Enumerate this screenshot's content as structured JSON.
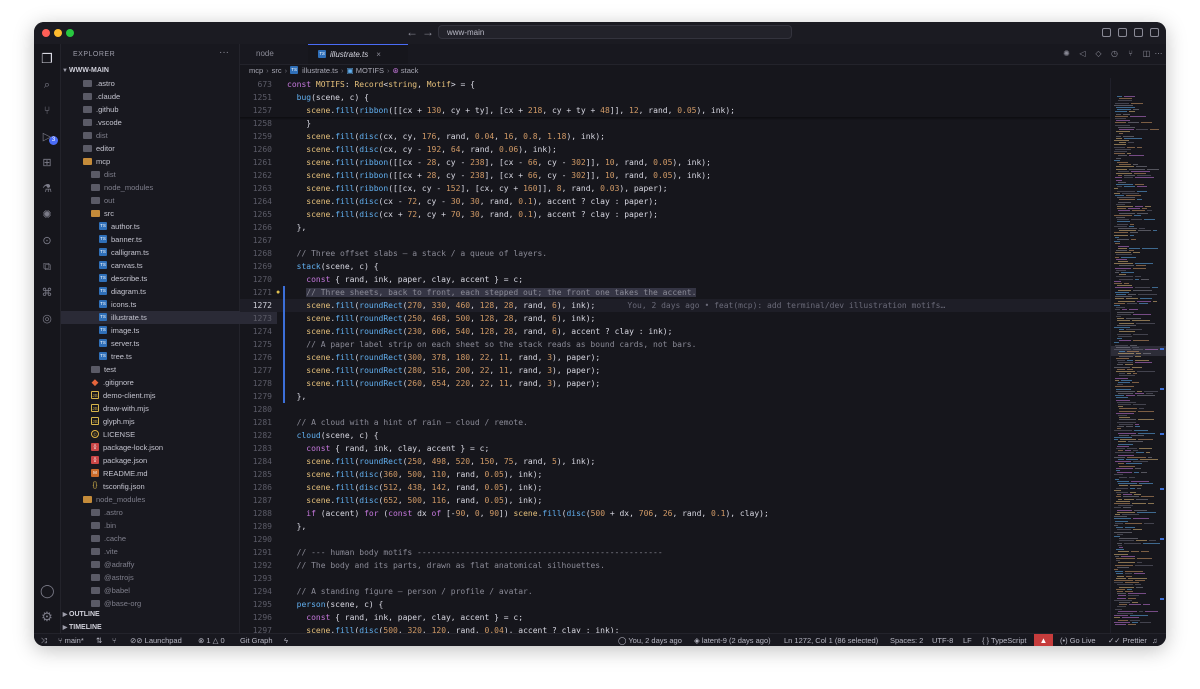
{
  "titlebar": {
    "search": "www-main",
    "back": "←",
    "forward": "→"
  },
  "explorer": {
    "header": "EXPLORER",
    "root": "WWW-MAIN",
    "items": [
      {
        "label": ".astro",
        "type": "folder",
        "depth": 1
      },
      {
        "label": ".claude",
        "type": "folder",
        "depth": 1
      },
      {
        "label": ".github",
        "type": "folder",
        "depth": 1
      },
      {
        "label": ".vscode",
        "type": "folder",
        "depth": 1
      },
      {
        "label": "dist",
        "type": "folder",
        "depth": 1,
        "dim": true
      },
      {
        "label": "editor",
        "type": "folder",
        "depth": 1
      },
      {
        "label": "mcp",
        "type": "folder-open",
        "depth": 1
      },
      {
        "label": "dist",
        "type": "folder",
        "depth": 2,
        "dim": true
      },
      {
        "label": "node_modules",
        "type": "folder",
        "depth": 2,
        "dim": true
      },
      {
        "label": "out",
        "type": "folder",
        "depth": 2,
        "dim": true
      },
      {
        "label": "src",
        "type": "folder-open",
        "depth": 2
      },
      {
        "label": "author.ts",
        "type": "ts",
        "depth": 3
      },
      {
        "label": "banner.ts",
        "type": "ts",
        "depth": 3
      },
      {
        "label": "calligram.ts",
        "type": "ts",
        "depth": 3
      },
      {
        "label": "canvas.ts",
        "type": "ts",
        "depth": 3
      },
      {
        "label": "describe.ts",
        "type": "ts",
        "depth": 3
      },
      {
        "label": "diagram.ts",
        "type": "ts",
        "depth": 3
      },
      {
        "label": "icons.ts",
        "type": "ts",
        "depth": 3
      },
      {
        "label": "illustrate.ts",
        "type": "ts",
        "depth": 3,
        "selected": true
      },
      {
        "label": "image.ts",
        "type": "ts",
        "depth": 3
      },
      {
        "label": "server.ts",
        "type": "ts",
        "depth": 3
      },
      {
        "label": "tree.ts",
        "type": "ts",
        "depth": 3
      },
      {
        "label": "test",
        "type": "folder",
        "depth": 2
      },
      {
        "label": ".gitignore",
        "type": "git",
        "depth": 2
      },
      {
        "label": "demo-client.mjs",
        "type": "mjs",
        "depth": 2
      },
      {
        "label": "draw-with.mjs",
        "type": "mjs",
        "depth": 2
      },
      {
        "label": "glyph.mjs",
        "type": "mjs",
        "depth": 2
      },
      {
        "label": "LICENSE",
        "type": "lic",
        "depth": 2
      },
      {
        "label": "package-lock.json",
        "type": "json",
        "depth": 2
      },
      {
        "label": "package.json",
        "type": "json",
        "depth": 2
      },
      {
        "label": "README.md",
        "type": "md",
        "depth": 2
      },
      {
        "label": "tsconfig.json",
        "type": "tsc",
        "depth": 2
      },
      {
        "label": "node_modules",
        "type": "folder-open",
        "depth": 1,
        "dim": true
      },
      {
        "label": ".astro",
        "type": "folder",
        "depth": 2,
        "dim": true
      },
      {
        "label": ".bin",
        "type": "folder",
        "depth": 2,
        "dim": true
      },
      {
        "label": ".cache",
        "type": "folder",
        "depth": 2,
        "dim": true
      },
      {
        "label": ".vite",
        "type": "folder",
        "depth": 2,
        "dim": true
      },
      {
        "label": "@adraffy",
        "type": "folder",
        "depth": 2,
        "dim": true
      },
      {
        "label": "@astrojs",
        "type": "folder",
        "depth": 2,
        "dim": true
      },
      {
        "label": "@babel",
        "type": "folder",
        "depth": 2,
        "dim": true
      },
      {
        "label": "@base-org",
        "type": "folder",
        "depth": 2,
        "dim": true
      }
    ],
    "outline": "OUTLINE",
    "timeline": "TIMELINE"
  },
  "tabs": [
    {
      "label": "node",
      "active": false
    },
    {
      "label": "illustrate.ts",
      "active": true
    }
  ],
  "breadcrumbs": [
    "mcp",
    "src",
    "illustrate.ts",
    "MOTIFS",
    "stack"
  ],
  "editor": {
    "blame": "You, 2 days ago • feat(mcp): add terminal/dev illustration motifs…",
    "lines": [
      {
        "n": "673",
        "html": "<span class=\"kw\">const</span> <span class=\"pr\">MOTIFS</span>: <span class=\"ty\">Record</span>&lt;<span class=\"ty\">string</span>, <span class=\"ty\">Motif</span>&gt; = {"
      },
      {
        "n": "1251",
        "html": "  <span class=\"fn\">bug</span>(scene, c) {"
      },
      {
        "n": "1257",
        "html": "    <span class=\"pr\">scene</span>.<span class=\"fn\">fill</span>(<span class=\"fn\">ribbon</span>([[cx + <span class=\"num\">130</span>, cy + ty], [cx + <span class=\"num\">218</span>, cy + ty + <span class=\"num\">48</span>]], <span class=\"num\">12</span>, rand, <span class=\"num\">0.05</span>), ink);"
      },
      {
        "n": "1258",
        "html": "    }"
      },
      {
        "n": "1259",
        "html": "    <span class=\"pr\">scene</span>.<span class=\"fn\">fill</span>(<span class=\"fn\">disc</span>(cx, cy, <span class=\"num\">176</span>, rand, <span class=\"num\">0.04</span>, <span class=\"num\">16</span>, <span class=\"num\">0.8</span>, <span class=\"num\">1.18</span>), ink);"
      },
      {
        "n": "1260",
        "html": "    <span class=\"pr\">scene</span>.<span class=\"fn\">fill</span>(<span class=\"fn\">disc</span>(cx, cy - <span class=\"num\">192</span>, <span class=\"num\">64</span>, rand, <span class=\"num\">0.06</span>), ink);"
      },
      {
        "n": "1261",
        "html": "    <span class=\"pr\">scene</span>.<span class=\"fn\">fill</span>(<span class=\"fn\">ribbon</span>([[cx - <span class=\"num\">28</span>, cy - <span class=\"num\">238</span>], [cx - <span class=\"num\">66</span>, cy - <span class=\"num\">302</span>]], <span class=\"num\">10</span>, rand, <span class=\"num\">0.05</span>), ink);"
      },
      {
        "n": "1262",
        "html": "    <span class=\"pr\">scene</span>.<span class=\"fn\">fill</span>(<span class=\"fn\">ribbon</span>([[cx + <span class=\"num\">28</span>, cy - <span class=\"num\">238</span>], [cx + <span class=\"num\">66</span>, cy - <span class=\"num\">302</span>]], <span class=\"num\">10</span>, rand, <span class=\"num\">0.05</span>), ink);"
      },
      {
        "n": "1263",
        "html": "    <span class=\"pr\">scene</span>.<span class=\"fn\">fill</span>(<span class=\"fn\">ribbon</span>([[cx, cy - <span class=\"num\">152</span>], [cx, cy + <span class=\"num\">160</span>]], <span class=\"num\">8</span>, rand, <span class=\"num\">0.03</span>), paper);"
      },
      {
        "n": "1264",
        "html": "    <span class=\"pr\">scene</span>.<span class=\"fn\">fill</span>(<span class=\"fn\">disc</span>(cx - <span class=\"num\">72</span>, cy - <span class=\"num\">30</span>, <span class=\"num\">30</span>, rand, <span class=\"num\">0.1</span>), accent ? clay : paper);"
      },
      {
        "n": "1265",
        "html": "    <span class=\"pr\">scene</span>.<span class=\"fn\">fill</span>(<span class=\"fn\">disc</span>(cx + <span class=\"num\">72</span>, cy + <span class=\"num\">70</span>, <span class=\"num\">30</span>, rand, <span class=\"num\">0.1</span>), accent ? clay : paper);"
      },
      {
        "n": "1266",
        "html": "  },"
      },
      {
        "n": "1267",
        "html": ""
      },
      {
        "n": "1268",
        "html": "  <span class=\"cmt\">// Three offset slabs — a stack / a queue of layers.</span>"
      },
      {
        "n": "1269",
        "html": "  <span class=\"fn\">stack</span>(scene, c) {"
      },
      {
        "n": "1270",
        "html": "    <span class=\"kw\">const</span> { rand, ink, paper, clay, accent } = c;"
      },
      {
        "n": "1271",
        "html": "    <span class=\"cmt hl\">// Three sheets, back to front, each stepped out; the front one takes the accent.</span>"
      },
      {
        "n": "1272",
        "html": "    <span class=\"pr\">scene</span>.<span class=\"fn\">fill</span>(<span class=\"fn\">roundRect</span>(<span class=\"num\">270</span>, <span class=\"num\">330</span>, <span class=\"num\">460</span>, <span class=\"num\">128</span>, <span class=\"num\">28</span>, rand, <span class=\"num\">6</span>), ink);",
        "current": true
      },
      {
        "n": "1273",
        "html": "    <span class=\"pr\">scene</span>.<span class=\"fn\">fill</span>(<span class=\"fn\">roundRect</span>(<span class=\"num\">250</span>, <span class=\"num\">468</span>, <span class=\"num\">500</span>, <span class=\"num\">128</span>, <span class=\"num\">28</span>, rand, <span class=\"num\">6</span>), ink);"
      },
      {
        "n": "1274",
        "html": "    <span class=\"pr\">scene</span>.<span class=\"fn\">fill</span>(<span class=\"fn\">roundRect</span>(<span class=\"num\">230</span>, <span class=\"num\">606</span>, <span class=\"num\">540</span>, <span class=\"num\">128</span>, <span class=\"num\">28</span>, rand, <span class=\"num\">6</span>), accent ? clay : ink);"
      },
      {
        "n": "1275",
        "html": "    <span class=\"cmt\">// A paper label strip on each sheet so the stack reads as bound cards, not bars.</span>"
      },
      {
        "n": "1276",
        "html": "    <span class=\"pr\">scene</span>.<span class=\"fn\">fill</span>(<span class=\"fn\">roundRect</span>(<span class=\"num\">300</span>, <span class=\"num\">378</span>, <span class=\"num\">180</span>, <span class=\"num\">22</span>, <span class=\"num\">11</span>, rand, <span class=\"num\">3</span>), paper);"
      },
      {
        "n": "1277",
        "html": "    <span class=\"pr\">scene</span>.<span class=\"fn\">fill</span>(<span class=\"fn\">roundRect</span>(<span class=\"num\">280</span>, <span class=\"num\">516</span>, <span class=\"num\">200</span>, <span class=\"num\">22</span>, <span class=\"num\">11</span>, rand, <span class=\"num\">3</span>), paper);"
      },
      {
        "n": "1278",
        "html": "    <span class=\"pr\">scene</span>.<span class=\"fn\">fill</span>(<span class=\"fn\">roundRect</span>(<span class=\"num\">260</span>, <span class=\"num\">654</span>, <span class=\"num\">220</span>, <span class=\"num\">22</span>, <span class=\"num\">11</span>, rand, <span class=\"num\">3</span>), paper);"
      },
      {
        "n": "1279",
        "html": "  },"
      },
      {
        "n": "1280",
        "html": ""
      },
      {
        "n": "1281",
        "html": "  <span class=\"cmt\">// A cloud with a hint of rain — cloud / remote.</span>"
      },
      {
        "n": "1282",
        "html": "  <span class=\"fn\">cloud</span>(scene, c) {"
      },
      {
        "n": "1283",
        "html": "    <span class=\"kw\">const</span> { rand, ink, clay, accent } = c;"
      },
      {
        "n": "1284",
        "html": "    <span class=\"pr\">scene</span>.<span class=\"fn\">fill</span>(<span class=\"fn\">roundRect</span>(<span class=\"num\">250</span>, <span class=\"num\">498</span>, <span class=\"num\">520</span>, <span class=\"num\">150</span>, <span class=\"num\">75</span>, rand, <span class=\"num\">5</span>), ink);"
      },
      {
        "n": "1285",
        "html": "    <span class=\"pr\">scene</span>.<span class=\"fn\">fill</span>(<span class=\"fn\">disc</span>(<span class=\"num\">360</span>, <span class=\"num\">500</span>, <span class=\"num\">110</span>, rand, <span class=\"num\">0.05</span>), ink);"
      },
      {
        "n": "1286",
        "html": "    <span class=\"pr\">scene</span>.<span class=\"fn\">fill</span>(<span class=\"fn\">disc</span>(<span class=\"num\">512</span>, <span class=\"num\">438</span>, <span class=\"num\">142</span>, rand, <span class=\"num\">0.05</span>), ink);"
      },
      {
        "n": "1287",
        "html": "    <span class=\"pr\">scene</span>.<span class=\"fn\">fill</span>(<span class=\"fn\">disc</span>(<span class=\"num\">652</span>, <span class=\"num\">500</span>, <span class=\"num\">116</span>, rand, <span class=\"num\">0.05</span>), ink);"
      },
      {
        "n": "1288",
        "html": "    <span class=\"kw\">if</span> (accent) <span class=\"kw\">for</span> (<span class=\"kw\">const</span> dx <span class=\"kw\">of</span> [-<span class=\"num\">90</span>, <span class=\"num\">0</span>, <span class=\"num\">90</span>]) <span class=\"pr\">scene</span>.<span class=\"fn\">fill</span>(<span class=\"fn\">disc</span>(<span class=\"num\">500</span> + dx, <span class=\"num\">706</span>, <span class=\"num\">26</span>, rand, <span class=\"num\">0.1</span>), clay);"
      },
      {
        "n": "1289",
        "html": "  },"
      },
      {
        "n": "1290",
        "html": ""
      },
      {
        "n": "1291",
        "html": "  <span class=\"cmt\">// --- human body motifs ---------------------------------------------------</span>"
      },
      {
        "n": "1292",
        "html": "  <span class=\"cmt\">// The body and its parts, drawn as flat anatomical silhouettes.</span>"
      },
      {
        "n": "1293",
        "html": ""
      },
      {
        "n": "1294",
        "html": "  <span class=\"cmt\">// A standing figure — person / profile / avatar.</span>"
      },
      {
        "n": "1295",
        "html": "  <span class=\"fn\">person</span>(scene, c) {"
      },
      {
        "n": "1296",
        "html": "    <span class=\"kw\">const</span> { rand, ink, paper, clay, accent } = c;"
      },
      {
        "n": "1297",
        "html": "    <span class=\"pr\">scene</span>.<span class=\"fn\">fill</span>(<span class=\"fn\">disc</span>(<span class=\"num\">500</span>, <span class=\"num\">320</span>, <span class=\"num\">120</span>, rand, <span class=\"num\">0.04</span>), accent ? clay : ink);"
      }
    ]
  },
  "status": {
    "branch": "main*",
    "launchpad": "Launchpad",
    "errors": "1",
    "warnings": "0",
    "gitgraph": "Git Graph",
    "blame": "You, 2 days ago",
    "tag": "latent-9 (2 days ago)",
    "position": "Ln 1272, Col 1 (86 selected)",
    "spaces": "Spaces: 2",
    "encoding": "UTF-8",
    "eol": "LF",
    "language": "TypeScript",
    "golive": "Go Live",
    "prettier": "Prettier"
  }
}
